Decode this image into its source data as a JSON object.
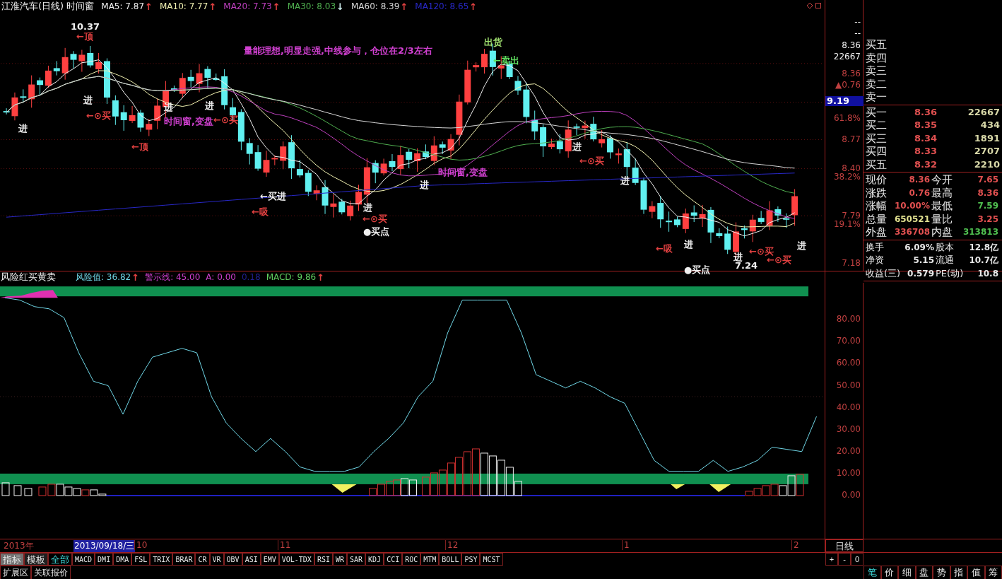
{
  "header": {
    "title": "江淮汽车(日线) 时间窗",
    "ma": [
      {
        "label": "MA5: 7.87",
        "arrow": {
          "text": "↑",
          "color": "#e04040"
        },
        "color": "#f0f0f0"
      },
      {
        "label": "MA10: 7.77",
        "arrow": {
          "text": "↑",
          "color": "#e04040"
        },
        "color": "#f0f0b0"
      },
      {
        "label": "MA20: 7.73",
        "arrow": {
          "text": "↑",
          "color": "#e04040"
        },
        "color": "#c040c0"
      },
      {
        "label": "MA30: 8.03",
        "arrow": {
          "text": "↓",
          "color": "#d0f0f0"
        },
        "color": "#50b050"
      },
      {
        "label": "MA60: 8.39",
        "arrow": {
          "text": "↑",
          "color": "#e04040"
        },
        "color": "#d8d8d8"
      },
      {
        "label": "MA120: 8.65",
        "arrow": {
          "text": "↑",
          "color": "#e04040"
        },
        "color": "#2828c8"
      }
    ]
  },
  "annotations": [
    {
      "text": "10.37",
      "color": "#f0f0f0"
    },
    {
      "text": "←顶",
      "color": "#e04040"
    },
    {
      "text": "进",
      "color": "#f0f0f0"
    },
    {
      "text": "←⊙买",
      "color": "#e04040"
    },
    {
      "text": "进",
      "color": "#f0f0f0"
    },
    {
      "text": "←顶",
      "color": "#e04040"
    },
    {
      "text": "进",
      "color": "#f0f0f0"
    },
    {
      "text": "进",
      "color": "#f0f0f0"
    },
    {
      "text": "时间窗,变盘",
      "color": "#d040d0"
    },
    {
      "text": "←⊙买",
      "color": "#e04040"
    },
    {
      "text": "←买进",
      "color": "#f0f0f0"
    },
    {
      "text": "←吸",
      "color": "#e04040"
    },
    {
      "text": "进",
      "color": "#f0f0f0"
    },
    {
      "text": "←⊙买",
      "color": "#e04040"
    },
    {
      "text": "●买点",
      "color": "#f0f0f0"
    },
    {
      "text": "进",
      "color": "#f0f0f0"
    },
    {
      "text": "时间窗,变盘",
      "color": "#d040d0"
    },
    {
      "text": "量能理想,明显走强,中线参与，仓位在2/3左右",
      "color": "#d040d0"
    },
    {
      "text": "出货",
      "color": "#a0e070"
    },
    {
      "text": "←卖出",
      "color": "#60e060"
    },
    {
      "text": "进",
      "color": "#f0f0f0"
    },
    {
      "text": "←⊙买",
      "color": "#e04040"
    },
    {
      "text": "进",
      "color": "#f0f0f0"
    },
    {
      "text": "←吸",
      "color": "#e04040"
    },
    {
      "text": "进",
      "color": "#f0f0f0"
    },
    {
      "text": "进",
      "color": "#f0f0f0"
    },
    {
      "text": "←⊙买",
      "color": "#e04040"
    },
    {
      "text": "←⊙买",
      "color": "#e04040"
    },
    {
      "text": "进",
      "color": "#f0f0f0"
    },
    {
      "text": "7.24",
      "color": "#f0f0f0"
    },
    {
      "text": "●买点",
      "color": "#f0f0f0"
    }
  ],
  "price_axis": [
    {
      "text": "--",
      "kind": "value",
      "color": "#f0f0f0"
    },
    {
      "text": "--",
      "kind": "value",
      "color": "#f0f0f0"
    },
    {
      "text": "8.36",
      "kind": "value",
      "color": "#f0f0f0"
    },
    {
      "text": "22667",
      "kind": "value",
      "color": "#f0f0f0"
    },
    {
      "text": "8.36",
      "kind": "value",
      "color": "#c04040"
    },
    {
      "text": "▲0.76",
      "kind": "value",
      "color": "#c04040"
    },
    {
      "text": "9.19",
      "kind": "cursor"
    },
    {
      "text": "61.8%",
      "kind": "value",
      "color": "#c04040"
    },
    {
      "text": "8.77",
      "kind": "value",
      "color": "#c04040"
    },
    {
      "text": "8.40",
      "kind": "value",
      "color": "#c04040"
    },
    {
      "text": "38.2%",
      "kind": "value",
      "color": "#c04040"
    },
    {
      "text": "7.79",
      "kind": "value",
      "color": "#c04040"
    },
    {
      "text": "19.1%",
      "kind": "value",
      "color": "#c04040"
    },
    {
      "text": "7.18",
      "kind": "value",
      "color": "#c04040"
    }
  ],
  "indicator": {
    "title": "风险红买黄卖",
    "readings": [
      {
        "label": "风险值: 36.82",
        "arrow": {
          "text": "↑",
          "color": "#e04040"
        },
        "color": "#70d8e8"
      },
      {
        "label": "警示线: 45.00",
        "color": "#d040d0"
      },
      {
        "label": "A: 0.00",
        "color": "#d040d0"
      },
      {
        "label": "0.18",
        "color": "#202090"
      },
      {
        "label": "MACD: 9.86",
        "arrow": {
          "text": "↑",
          "color": "#e04040"
        },
        "color": "#60d060"
      }
    ],
    "chart_data": {
      "type": "line",
      "ylim": [
        -19.6,
        96.8
      ],
      "yticks": [
        {
          "value": 0,
          "label": "0.00"
        },
        {
          "value": 10,
          "label": "10.00"
        },
        {
          "value": 20,
          "label": "20.00"
        },
        {
          "value": 30,
          "label": "30.00"
        },
        {
          "value": 40,
          "label": "40.00"
        },
        {
          "value": 50,
          "label": "50.00"
        },
        {
          "value": 60,
          "label": "60.00"
        },
        {
          "value": 70,
          "label": "70.00"
        },
        {
          "value": 80,
          "label": "80.00"
        }
      ],
      "series": [
        {
          "color": "#70d8e8",
          "values": [
            90,
            89,
            86,
            85,
            81,
            65,
            52,
            50,
            37,
            52,
            63,
            65,
            67,
            65,
            45,
            33,
            26,
            20,
            26,
            20,
            13,
            11,
            11,
            11,
            13,
            20,
            26,
            33,
            45,
            52,
            74,
            89,
            89,
            89,
            89,
            74,
            55,
            52,
            49,
            52,
            49,
            45,
            42,
            29,
            16,
            11,
            11,
            11,
            16,
            11,
            13,
            16,
            22,
            21,
            20,
            36
          ]
        }
      ]
    }
  },
  "quote": {
    "sell": [
      {
        "label": "买五"
      },
      {
        "label": "卖四"
      },
      {
        "label": "卖三"
      },
      {
        "label": "卖二"
      },
      {
        "label": "卖一"
      }
    ],
    "buy": [
      {
        "label": "买一",
        "price": "8.36",
        "volume": "22667"
      },
      {
        "label": "买二",
        "price": "8.35",
        "volume": "434"
      },
      {
        "label": "买三",
        "price": "8.34",
        "volume": "1891"
      },
      {
        "label": "买四",
        "price": "8.33",
        "volume": "2707"
      },
      {
        "label": "买五",
        "price": "8.32",
        "volume": "2210"
      }
    ],
    "stats": [
      {
        "label": "现价",
        "value": "8.36",
        "color": "#e05050"
      },
      {
        "label": "今开",
        "value": "7.65",
        "color": "#e05050"
      },
      {
        "label": "涨跌",
        "value": "0.76",
        "color": "#e05050"
      },
      {
        "label": "最高",
        "value": "8.36",
        "color": "#e05050"
      },
      {
        "label": "涨幅",
        "value": "10.00%",
        "color": "#e05050"
      },
      {
        "label": "最低",
        "value": "7.59",
        "color": "#50c050"
      },
      {
        "label": "总量",
        "value": "650521",
        "color": "#e0e090"
      },
      {
        "label": "量比",
        "value": "3.25",
        "color": "#e05050"
      },
      {
        "label": "外盘",
        "value": "336708",
        "color": "#e05050"
      },
      {
        "label": "内盘",
        "value": "313813",
        "color": "#50c050"
      }
    ],
    "info": [
      {
        "label": "换手",
        "value": "6.09%"
      },
      {
        "label": "股本",
        "value": "12.8亿"
      },
      {
        "label": "净资",
        "value": "5.15"
      },
      {
        "label": "流通",
        "value": "10.7亿"
      },
      {
        "label": "收益(三)",
        "value": "0.579"
      },
      {
        "label": "PE(动)",
        "value": "10.8"
      }
    ]
  },
  "timeline": {
    "year": "2013年",
    "cursor_date": "2013/09/18/三",
    "months": [
      "10",
      "11",
      "12",
      "1",
      "2"
    ],
    "period": "日线"
  },
  "toolbar": {
    "modes": [
      {
        "label": "指标",
        "selected": true
      },
      {
        "label": "模板",
        "selected": false
      }
    ],
    "indicators": [
      {
        "label": "全部",
        "selected": true
      },
      {
        "label": "MACD",
        "selected": false
      },
      {
        "label": "DMI",
        "selected": false
      },
      {
        "label": "DMA",
        "selected": false
      },
      {
        "label": "FSL",
        "selected": false
      },
      {
        "label": "TRIX",
        "selected": false
      },
      {
        "label": "BRAR",
        "selected": false
      },
      {
        "label": "CR",
        "selected": false
      },
      {
        "label": "VR",
        "selected": false
      },
      {
        "label": "OBV",
        "selected": false
      },
      {
        "label": "ASI",
        "selected": false
      },
      {
        "label": "EMV",
        "selected": false
      },
      {
        "label": "VOL-TDX",
        "selected": false
      },
      {
        "label": "RSI",
        "selected": false
      },
      {
        "label": "WR",
        "selected": false
      },
      {
        "label": "SAR",
        "selected": false
      },
      {
        "label": "KDJ",
        "selected": false
      },
      {
        "label": "CCI",
        "selected": false
      },
      {
        "label": "ROC",
        "selected": false
      },
      {
        "label": "MTM",
        "selected": false
      },
      {
        "label": "BOLL",
        "selected": false
      },
      {
        "label": "PSY",
        "selected": false
      },
      {
        "label": "MCST",
        "selected": false
      }
    ],
    "zoom": [
      "+",
      "-",
      "0"
    ]
  },
  "bottom": {
    "tabs": [
      {
        "label": "扩展区"
      },
      {
        "label": "关联报价"
      }
    ],
    "panel_tabs": [
      {
        "label": "笔",
        "selected": true
      },
      {
        "label": "价",
        "selected": false
      },
      {
        "label": "细",
        "selected": false
      },
      {
        "label": "盘",
        "selected": false
      },
      {
        "label": "势",
        "selected": false
      },
      {
        "label": "指",
        "selected": false
      },
      {
        "label": "值",
        "selected": false
      },
      {
        "label": "筹",
        "selected": false
      }
    ]
  }
}
